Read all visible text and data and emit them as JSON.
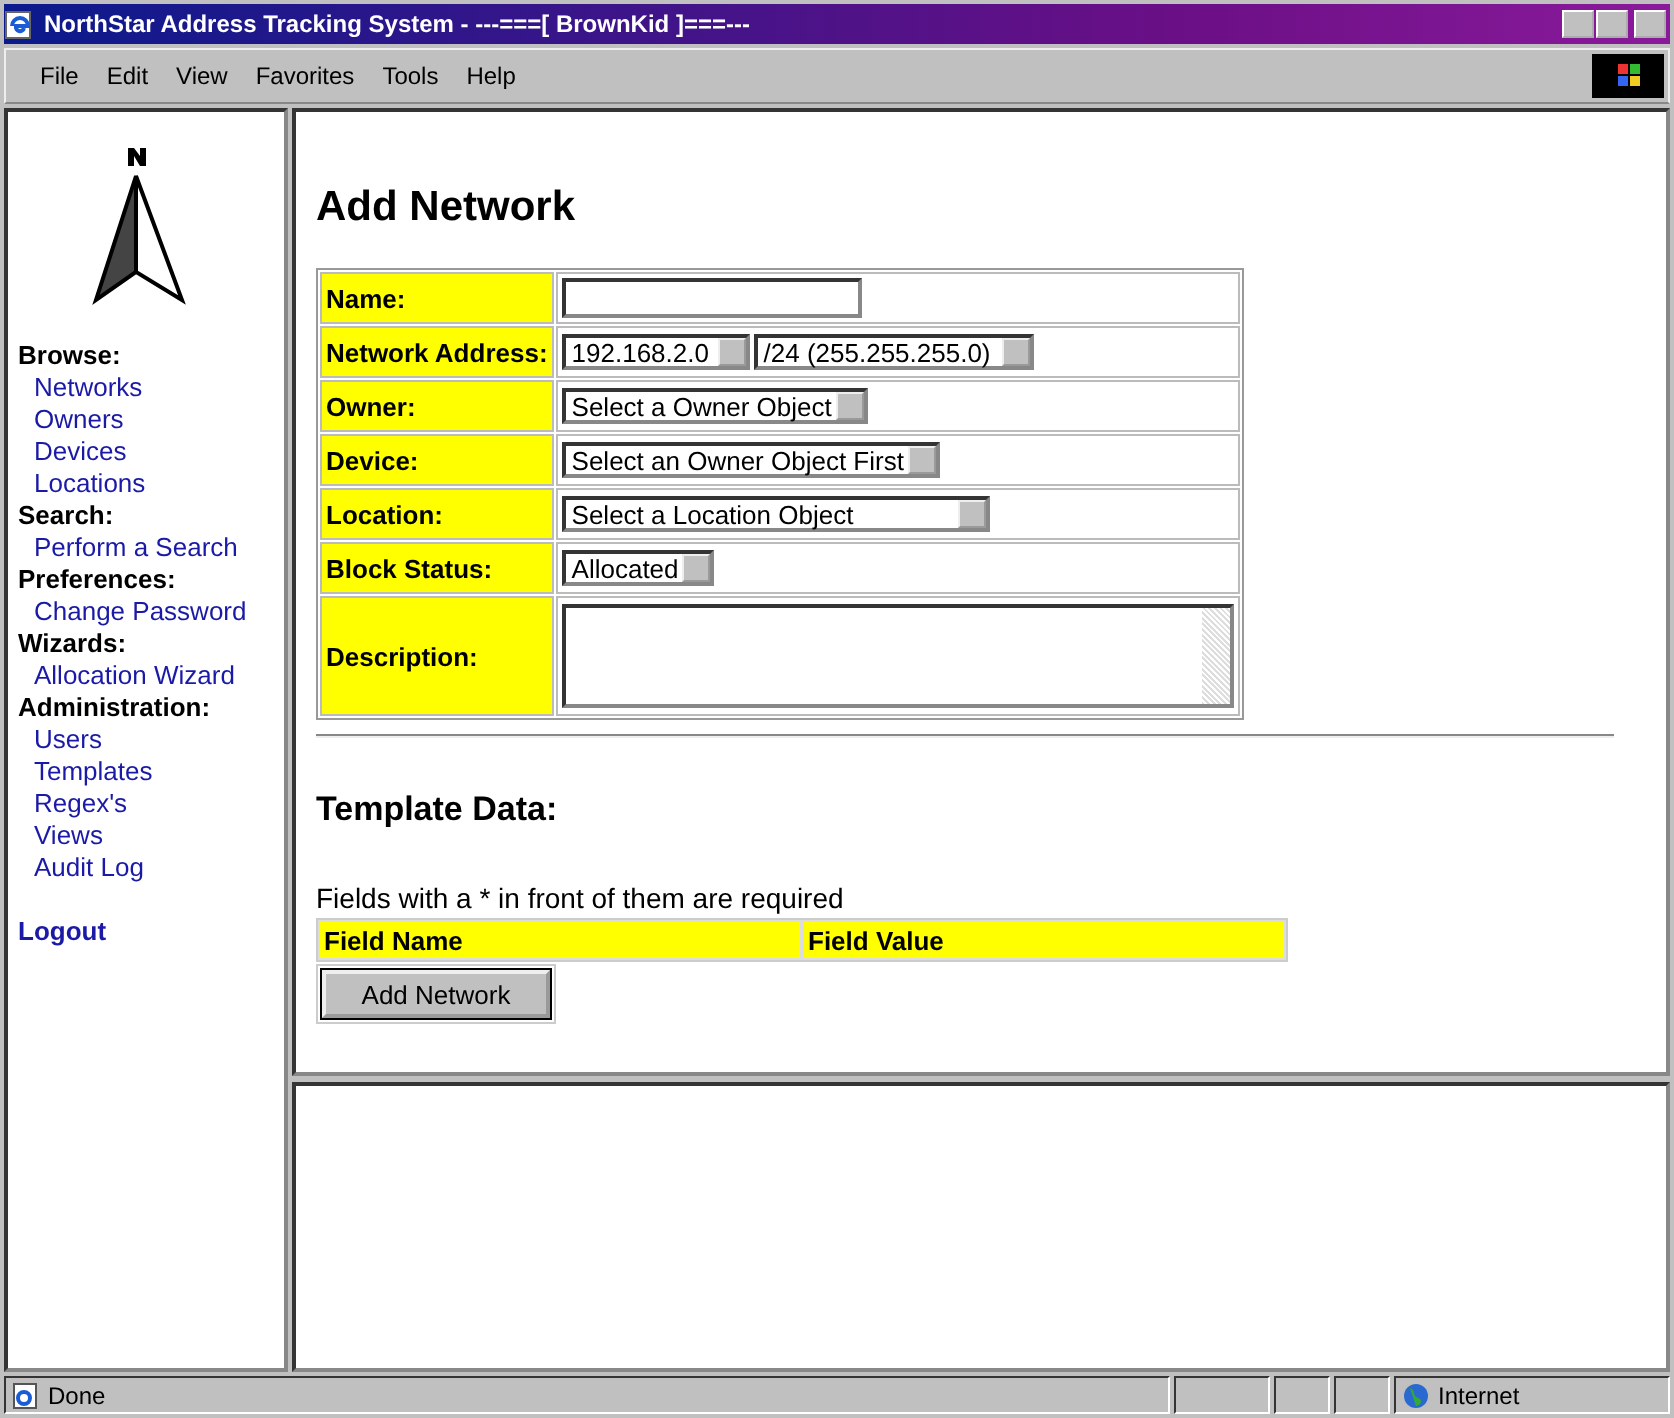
{
  "window": {
    "title": "NorthStar Address Tracking System - ---===[ BrownKid ]===---"
  },
  "menu": [
    "File",
    "Edit",
    "View",
    "Favorites",
    "Tools",
    "Help"
  ],
  "sidebar": {
    "sections": [
      {
        "heading": "Browse:",
        "links": [
          "Networks",
          "Owners",
          "Devices",
          "Locations"
        ]
      },
      {
        "heading": "Search:",
        "links": [
          "Perform a Search"
        ]
      },
      {
        "heading": "Preferences:",
        "links": [
          "Change Password"
        ]
      },
      {
        "heading": "Wizards:",
        "links": [
          "Allocation Wizard"
        ]
      },
      {
        "heading": "Administration:",
        "links": [
          "Users",
          "Templates",
          "Regex's",
          "Views",
          "Audit Log"
        ]
      }
    ],
    "logout": "Logout"
  },
  "page": {
    "heading": "Add Network",
    "form": [
      {
        "label": "Name:",
        "kind": "text"
      },
      {
        "label": "Network Address:",
        "kind": "select",
        "selects": [
          "192.168.2.0",
          "/24 (255.255.255.0)"
        ]
      },
      {
        "label": "Owner:",
        "kind": "select",
        "selects": [
          "Select a Owner Object"
        ]
      },
      {
        "label": "Device:",
        "kind": "select",
        "selects": [
          "Select an Owner Object First"
        ]
      },
      {
        "label": "Location:",
        "kind": "select",
        "selects": [
          "Select a Location Object"
        ]
      },
      {
        "label": "Block Status:",
        "kind": "select",
        "selects": [
          "Allocated"
        ]
      },
      {
        "label": "Description:",
        "kind": "textarea"
      }
    ],
    "template_heading": "Template Data:",
    "note": "Fields with a * in front of them are required",
    "template_columns": [
      "Field Name",
      "Field Value"
    ],
    "submit": "Add Network"
  },
  "status_bar": {
    "text": "Done",
    "zone": "Internet"
  }
}
